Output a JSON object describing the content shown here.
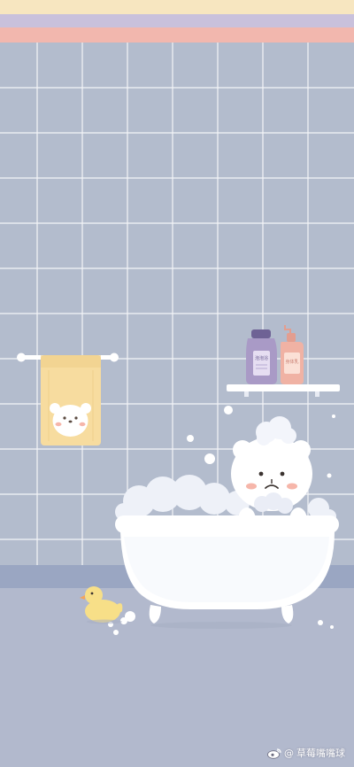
{
  "wallpaper": {
    "stripe_colors": [
      "#f7e6c0",
      "#c9c1dc",
      "#f2b7ae"
    ],
    "wall_tile_color": "#b3bccd",
    "grout_color": "#ffffff",
    "floor_color": "#b2b9cd",
    "baseboard_color": "#9aa6c2"
  },
  "shelf": {
    "bottles": [
      {
        "name": "purple-bottle",
        "color": "#a99ac6",
        "label_text": "泡泡浴"
      },
      {
        "name": "pink-bottle",
        "color": "#f0b2a4",
        "label_text": "身体乳"
      }
    ]
  },
  "towel": {
    "color": "#f7dc9f"
  },
  "duck": {
    "color": "#f7df88",
    "beak_color": "#f4a45c"
  },
  "watermark": {
    "prefix": "@",
    "text": "草莓嘴嘴球"
  }
}
